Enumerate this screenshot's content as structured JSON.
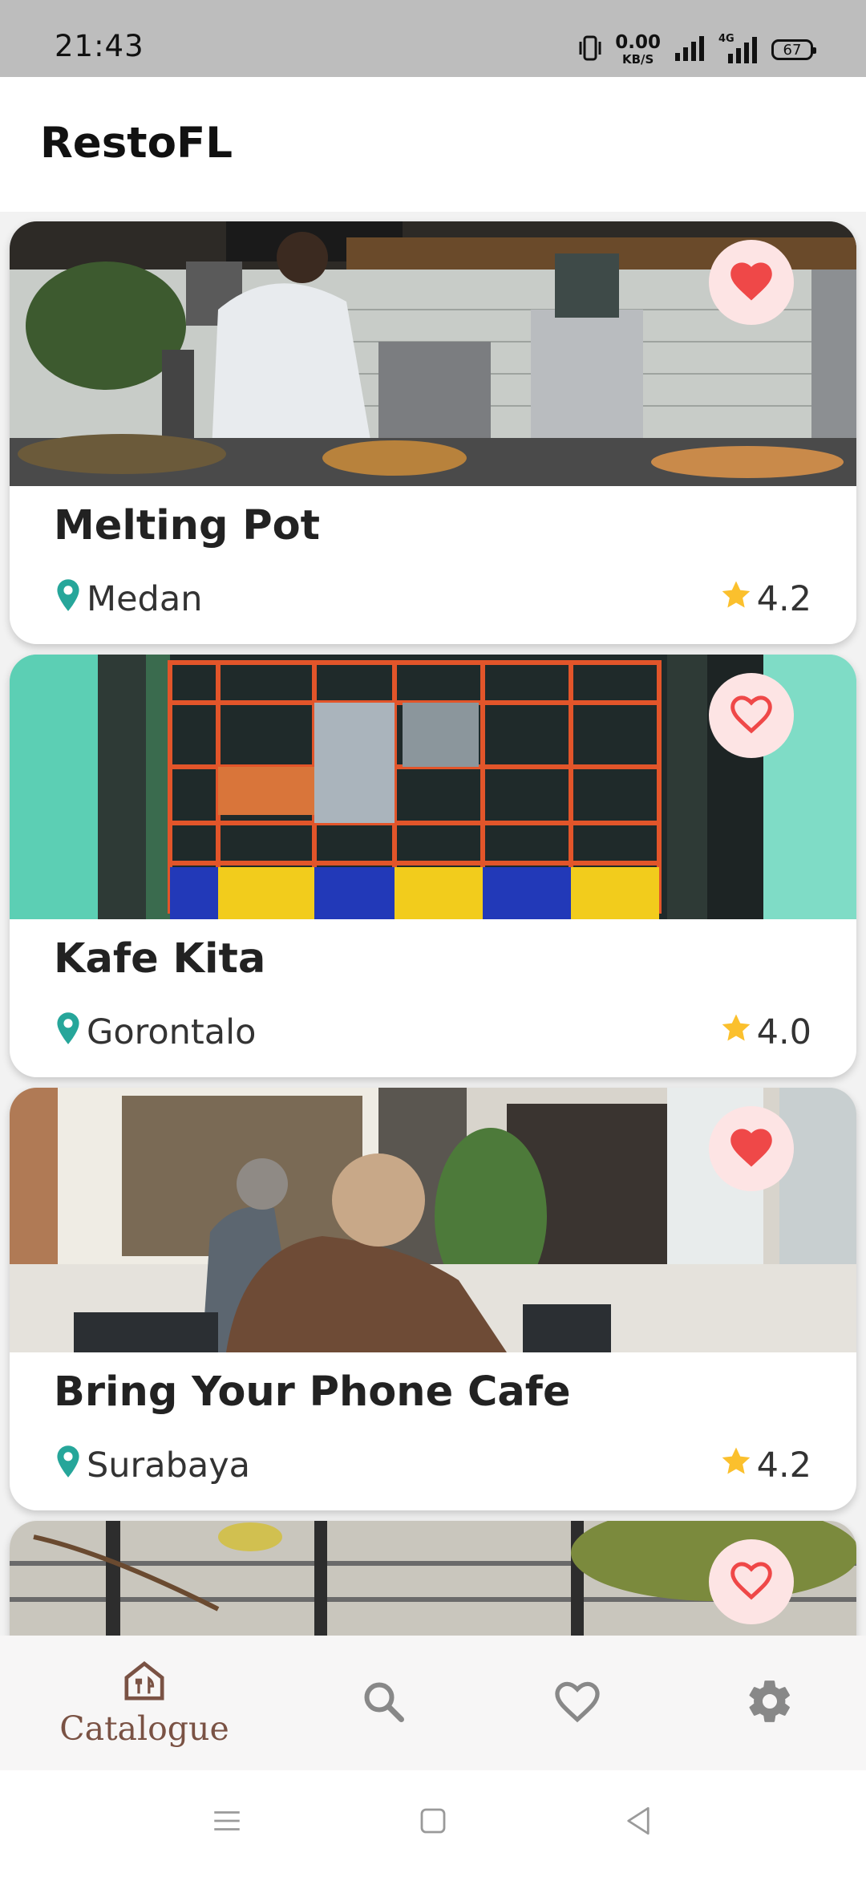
{
  "status_bar": {
    "time": "21:43",
    "net_speed_value": "0.00",
    "net_speed_unit": "KB/S",
    "network_label": "4G",
    "battery_level": "67",
    "icons": [
      "vibrate-icon",
      "signal-icon",
      "signal-4g-icon",
      "battery-icon"
    ]
  },
  "app_bar": {
    "title": "RestoFL"
  },
  "restaurants": [
    {
      "name": "Melting Pot",
      "city": "Medan",
      "rating": "4.2",
      "favorited": true
    },
    {
      "name": "Kafe Kita",
      "city": "Gorontalo",
      "rating": "4.0",
      "favorited": false
    },
    {
      "name": "Bring Your Phone Cafe",
      "city": "Surabaya",
      "rating": "4.2",
      "favorited": true
    },
    {
      "favorited": false
    }
  ],
  "bottom_nav": {
    "items": [
      {
        "icon": "restaurant-home-icon",
        "label": "Catalogue",
        "active": true
      },
      {
        "icon": "search-icon",
        "active": false
      },
      {
        "icon": "heart-outline-icon",
        "active": false
      },
      {
        "icon": "gear-icon",
        "active": false
      }
    ]
  },
  "system_nav": {
    "icons": [
      "menu-icon",
      "home-icon",
      "back-icon"
    ]
  },
  "colors": {
    "heart": "#ef4848",
    "fav_button_bg": "#fde4e4",
    "location_pin": "#26a69a",
    "star": "#fbc02d",
    "nav_active": "#7a5244",
    "nav_inactive": "#888888"
  }
}
